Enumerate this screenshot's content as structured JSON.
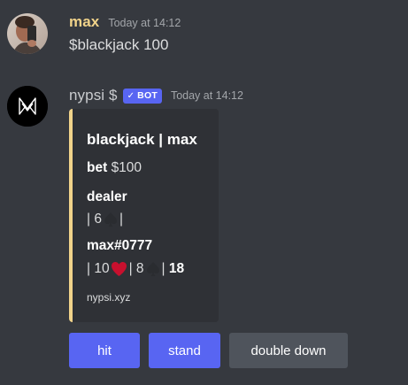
{
  "messages": [
    {
      "username": "max",
      "timestamp": "Today at 14:12",
      "content": "$blackjack 100",
      "avatar": "user-photo-avatar"
    },
    {
      "username": "nypsi $",
      "badge": "BOT",
      "badge_check": "✓",
      "timestamp": "Today at 14:12",
      "avatar": "nypsi-logo-avatar",
      "embed": {
        "accent_color": "#f1d38a",
        "title": "blackjack | max",
        "bet_label": "bet",
        "bet_value": "$100",
        "dealer_label": "dealer",
        "dealer_cards": {
          "prefix": "| 6",
          "suffix": "|"
        },
        "player_label": "max#0777",
        "player_cards": {
          "card1": "| 10",
          "card2": "| 8",
          "sep": "|",
          "total": "18"
        },
        "footer": "nypsi.xyz"
      },
      "buttons": [
        {
          "label": "hit",
          "style": "primary"
        },
        {
          "label": "stand",
          "style": "primary"
        },
        {
          "label": "double down",
          "style": "secondary"
        }
      ]
    }
  ],
  "colors": {
    "background": "#36393f",
    "embed_bg": "#2f3136",
    "primary_button": "#5865f2",
    "secondary_button": "#4f545c",
    "username_max": "#f1d38a"
  }
}
